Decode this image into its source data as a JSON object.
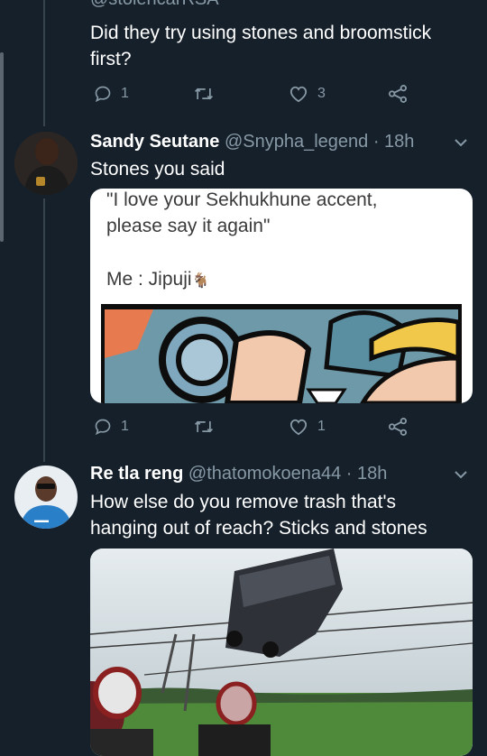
{
  "tweets": [
    {
      "handle_partial": "@stolencarRSA",
      "text": "Did they try using stones and broomstick first?",
      "replies": "1",
      "retweets": "",
      "likes": "3"
    },
    {
      "name": "Sandy Seutane",
      "handle": "@Snypha_legend",
      "time": "· 18h",
      "text": "Stones you said",
      "media": {
        "line1": "\"I love your Sekhukhune accent,",
        "line2": "please say it again\"",
        "line3": "Me : Jipuji",
        "emoji": "🐐"
      },
      "replies": "1",
      "retweets": "",
      "likes": "1"
    },
    {
      "name": "Re tla reng",
      "handle": "@thatomokoena44",
      "time": "· 18h",
      "text_line1": "How else do you remove trash that's",
      "text_line2": "hanging out of reach? Sticks and stones"
    }
  ],
  "icons": [
    "reply-icon",
    "retweet-icon",
    "like-icon",
    "share-icon",
    "chevron-down-icon"
  ]
}
